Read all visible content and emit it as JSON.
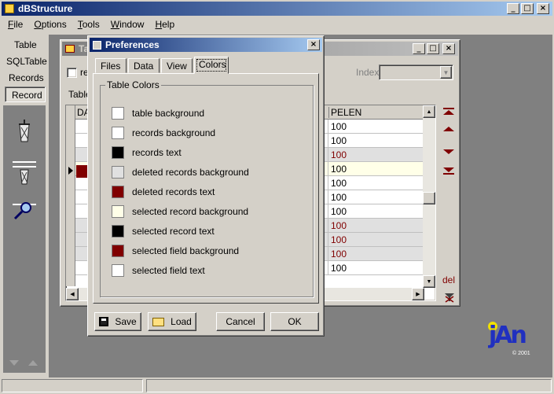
{
  "app": {
    "title": "dBStructure"
  },
  "menu": [
    "File",
    "Options",
    "Tools",
    "Window",
    "Help"
  ],
  "left_nav": {
    "items": [
      "Table",
      "SQLTable",
      "Records",
      "Record"
    ]
  },
  "table_window": {
    "title": "Ta",
    "checkbox_label": "re",
    "index_label": "Index",
    "tab_label": "Table",
    "col_left": "DA",
    "col_right": "PELEN",
    "rows": [
      {
        "v": "100",
        "red": false,
        "bg": "#fff"
      },
      {
        "v": "100",
        "red": false,
        "bg": "#fff"
      },
      {
        "v": "100",
        "red": true,
        "bg": "#e0e0e0"
      },
      {
        "v": "100",
        "red": false,
        "bg": "#ffffe8"
      },
      {
        "v": "100",
        "red": false,
        "bg": "#fff"
      },
      {
        "v": "100",
        "red": false,
        "bg": "#fff"
      },
      {
        "v": "100",
        "red": false,
        "bg": "#fff"
      },
      {
        "v": "100",
        "red": true,
        "bg": "#e0e0e0"
      },
      {
        "v": "100",
        "red": true,
        "bg": "#e0e0e0"
      },
      {
        "v": "100",
        "red": true,
        "bg": "#e0e0e0"
      },
      {
        "v": "100",
        "red": false,
        "bg": "#fff"
      }
    ],
    "del_label": "del"
  },
  "preferences": {
    "title": "Preferences",
    "tabs": [
      "Files",
      "Data",
      "View",
      "Colors"
    ],
    "active_tab": "Colors",
    "group_label": "Table Colors",
    "colors": [
      {
        "label": "table background",
        "color": "#ffffff"
      },
      {
        "label": "records background",
        "color": "#ffffff"
      },
      {
        "label": "records text",
        "color": "#000000"
      },
      {
        "label": "deleted records background",
        "color": "#e0e0e0"
      },
      {
        "label": "deleted records text",
        "color": "#800000"
      },
      {
        "label": "selected record background",
        "color": "#ffffe8"
      },
      {
        "label": "selected record text",
        "color": "#000000"
      },
      {
        "label": "selected field background",
        "color": "#800000"
      },
      {
        "label": "selected field text",
        "color": "#ffffff"
      }
    ],
    "buttons": {
      "save": "Save",
      "load": "Load",
      "cancel": "Cancel",
      "ok": "OK"
    }
  },
  "logo": {
    "text": "jAn",
    "copyright": "© 2001"
  }
}
